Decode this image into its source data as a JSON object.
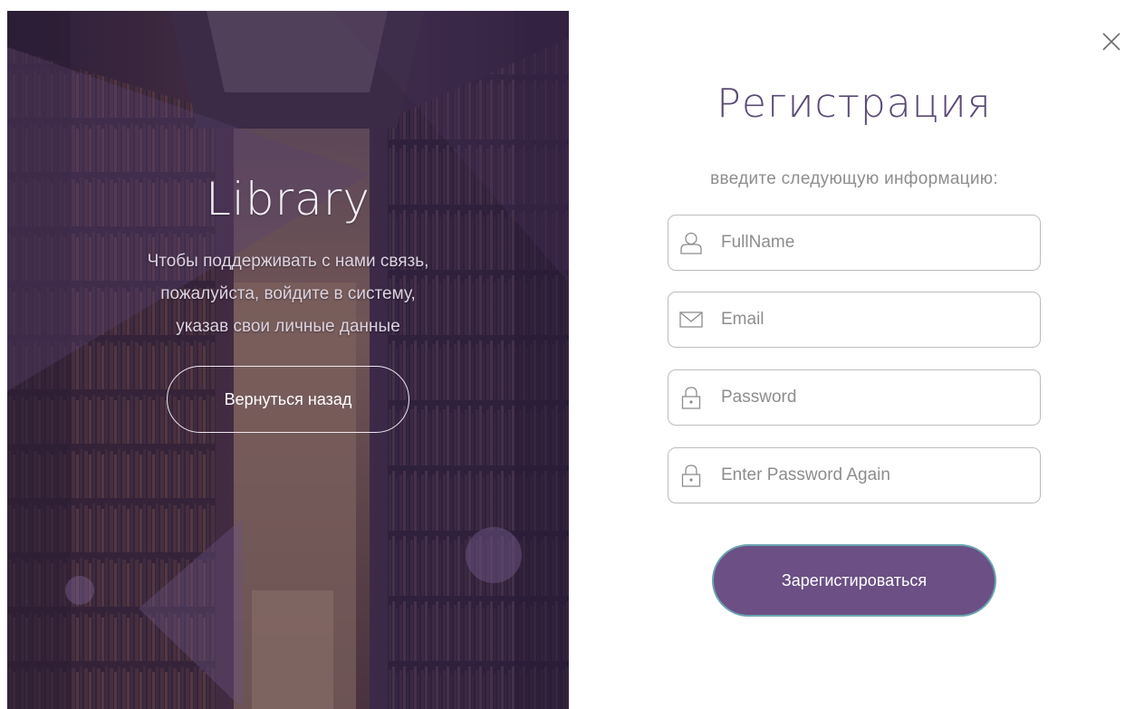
{
  "left_panel": {
    "title": "Library",
    "description": "Чтобы поддерживать с нами связь, пожалуйста, войдите в систему, указав свои личные данные",
    "back_button_label": "Вернуться назад",
    "background_image": "library-interior-photo"
  },
  "close_icon": "close-icon",
  "form": {
    "title": "Регистрация",
    "subtitle": "введите следующую информацию:",
    "fields": [
      {
        "name": "fullname",
        "placeholder": "FullName",
        "value": "",
        "icon": "user-icon"
      },
      {
        "name": "email",
        "placeholder": "Email",
        "value": "",
        "icon": "envelope-icon"
      },
      {
        "name": "password",
        "placeholder": "Password",
        "value": "",
        "icon": "lock-icon"
      },
      {
        "name": "password-again",
        "placeholder": "Enter Password Again",
        "value": "",
        "icon": "lock-icon"
      }
    ],
    "submit_label": "Зарегистироваться"
  },
  "colors": {
    "accent": "#6b4f85",
    "title": "#5a4a75",
    "submit_border": "#6aa5b0",
    "overlay": "#3c2a4d"
  }
}
